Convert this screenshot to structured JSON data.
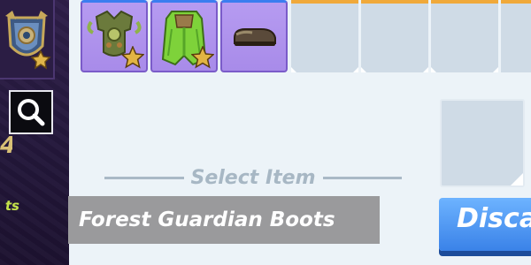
{
  "sidebar": {
    "hero_portrait_icon": "shield-crest-icon",
    "search_icon": "search-icon",
    "number_fragment": "4",
    "text_fragment": "ts"
  },
  "inventory": {
    "slots": [
      {
        "item": "forest-guardian-chestplate",
        "icon": "armor-chest-icon",
        "starred": true
      },
      {
        "item": "forest-guardian-cape",
        "icon": "green-cape-icon",
        "starred": true
      },
      {
        "item": "forest-guardian-boots",
        "icon": "boots-icon",
        "starred": false
      },
      {
        "item": null
      },
      {
        "item": null
      },
      {
        "item": null
      }
    ]
  },
  "main": {
    "select_item_label": "Select Item",
    "selected_item_name": "Forest Guardian Boots",
    "discard_label": "Disca"
  },
  "colors": {
    "slot_filled": "#b69bf1",
    "slot_empty": "#cfdbe6",
    "sidebar_bg": "#2a1c42",
    "discard_button": "#4a90f0"
  }
}
